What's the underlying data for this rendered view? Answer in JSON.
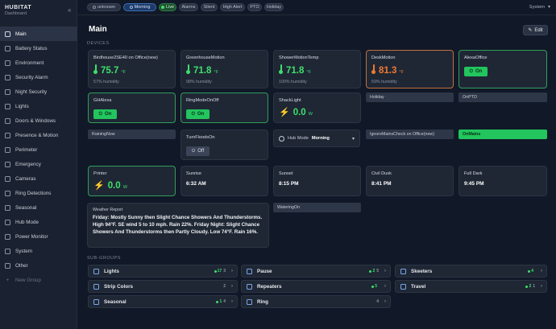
{
  "app": {
    "brand": "HUBITAT",
    "subtitle": "Dashboard"
  },
  "sidebar": {
    "items": [
      {
        "label": "Main",
        "icon": "home-icon"
      },
      {
        "label": "Battery Status",
        "icon": "battery-icon"
      },
      {
        "label": "Environment",
        "icon": "thermometer-icon"
      },
      {
        "label": "Security Alarm",
        "icon": "shield-icon"
      },
      {
        "label": "Night Security",
        "icon": "moon-icon"
      },
      {
        "label": "Lights",
        "icon": "bulb-icon"
      },
      {
        "label": "Doors & Windows",
        "icon": "door-icon"
      },
      {
        "label": "Presence & Motion",
        "icon": "user-icon"
      },
      {
        "label": "Perimeter",
        "icon": "fence-icon"
      },
      {
        "label": "Emergency",
        "icon": "alert-icon"
      },
      {
        "label": "Cameras",
        "icon": "camera-icon"
      },
      {
        "label": "Ring Detections",
        "icon": "bell-icon"
      },
      {
        "label": "Seasonal",
        "icon": "leaf-icon"
      },
      {
        "label": "Hub Mode",
        "icon": "clock-icon"
      },
      {
        "label": "Power Monitor",
        "icon": "bolt-icon"
      },
      {
        "label": "System",
        "icon": "gear-icon"
      },
      {
        "label": "Other",
        "icon": "folder-icon"
      }
    ],
    "new_group": "New Group"
  },
  "topbar": {
    "pills": [
      "unknown",
      "Morning",
      "Live",
      "Alarms",
      "Silent",
      "High Alert",
      "PTO",
      "Holiday"
    ],
    "system": "System"
  },
  "page": {
    "title": "Main",
    "edit": "Edit",
    "devices_label": "DEVICES",
    "subgroups_label": "SUB-GROUPS"
  },
  "devices": {
    "birdhouse": {
      "name": "Birdhouse2SE40 on Office(new)",
      "value": "75.7",
      "unit": "°F",
      "humidity": "57% humidity"
    },
    "greenhouse": {
      "name": "GreenhouseMotion",
      "value": "71.8",
      "unit": "°F",
      "humidity": "98% humidity"
    },
    "shower": {
      "name": "ShowerMotionTemp",
      "value": "71.8",
      "unit": "°F",
      "humidity": "100% humidity"
    },
    "desk": {
      "name": "DeskMotion",
      "value": "81.3",
      "unit": "°F",
      "humidity": "59% humidity"
    },
    "alexa": {
      "name": "AlexaOffice",
      "state": "On"
    },
    "ghalexa": {
      "name": "GHAlexa",
      "state": "On"
    },
    "ringmode": {
      "name": "RingModeOnOff",
      "state": "On"
    },
    "shacklight": {
      "name": "ShackLight",
      "value": "0.0",
      "unit": "W"
    },
    "holiday": "Holiday",
    "onpto": "OnPTO",
    "raining": "RainingNow",
    "turnfloods": {
      "name": "TurnFloodsOn",
      "state": "Off"
    },
    "hubmode": {
      "label": "Hub Mode",
      "value": "Morning"
    },
    "ignoremains": "IgnoreMainsCheck on Office(new)",
    "onmains": "OnMains",
    "printer": {
      "name": "Printer",
      "value": "0.0",
      "unit": "W"
    },
    "sunrise": {
      "name": "Sunrise",
      "value": "6:32 AM"
    },
    "sunset": {
      "name": "Sunset",
      "value": "8:15 PM"
    },
    "civildusk": {
      "name": "Civil Dusk",
      "value": "8:41 PM"
    },
    "fulldark": {
      "name": "Full Dark",
      "value": "9:45 PM"
    },
    "watering": "WateringOn",
    "weather": {
      "title": "Weather Report",
      "text": "Friday: Mostly Sunny then Slight Chance Showers And Thunderstorms. High 94°F. SE wind 5 to 10 mph. Rain 22%. Friday Night: Slight Chance Showers And Thunderstorms then Partly Cloudy. Low 74°F. Rain 16%."
    }
  },
  "subgroups": [
    {
      "name": "Lights",
      "on": "17",
      "total": "3"
    },
    {
      "name": "Pause",
      "on": "2",
      "total": "5"
    },
    {
      "name": "Skeeters",
      "on": "4",
      "total": ""
    },
    {
      "name": "Strip Colors",
      "on": "",
      "total": "2"
    },
    {
      "name": "Repeaters",
      "on": "5",
      "total": ""
    },
    {
      "name": "Travel",
      "on": "2",
      "total": "1"
    },
    {
      "name": "Seasonal",
      "on": "1",
      "total": "4"
    },
    {
      "name": "Ring",
      "on": "",
      "total": "4"
    }
  ],
  "colors": {
    "accent_green": "#22c55e",
    "temp_orange": "#f07a2f",
    "bg": "#111827"
  }
}
